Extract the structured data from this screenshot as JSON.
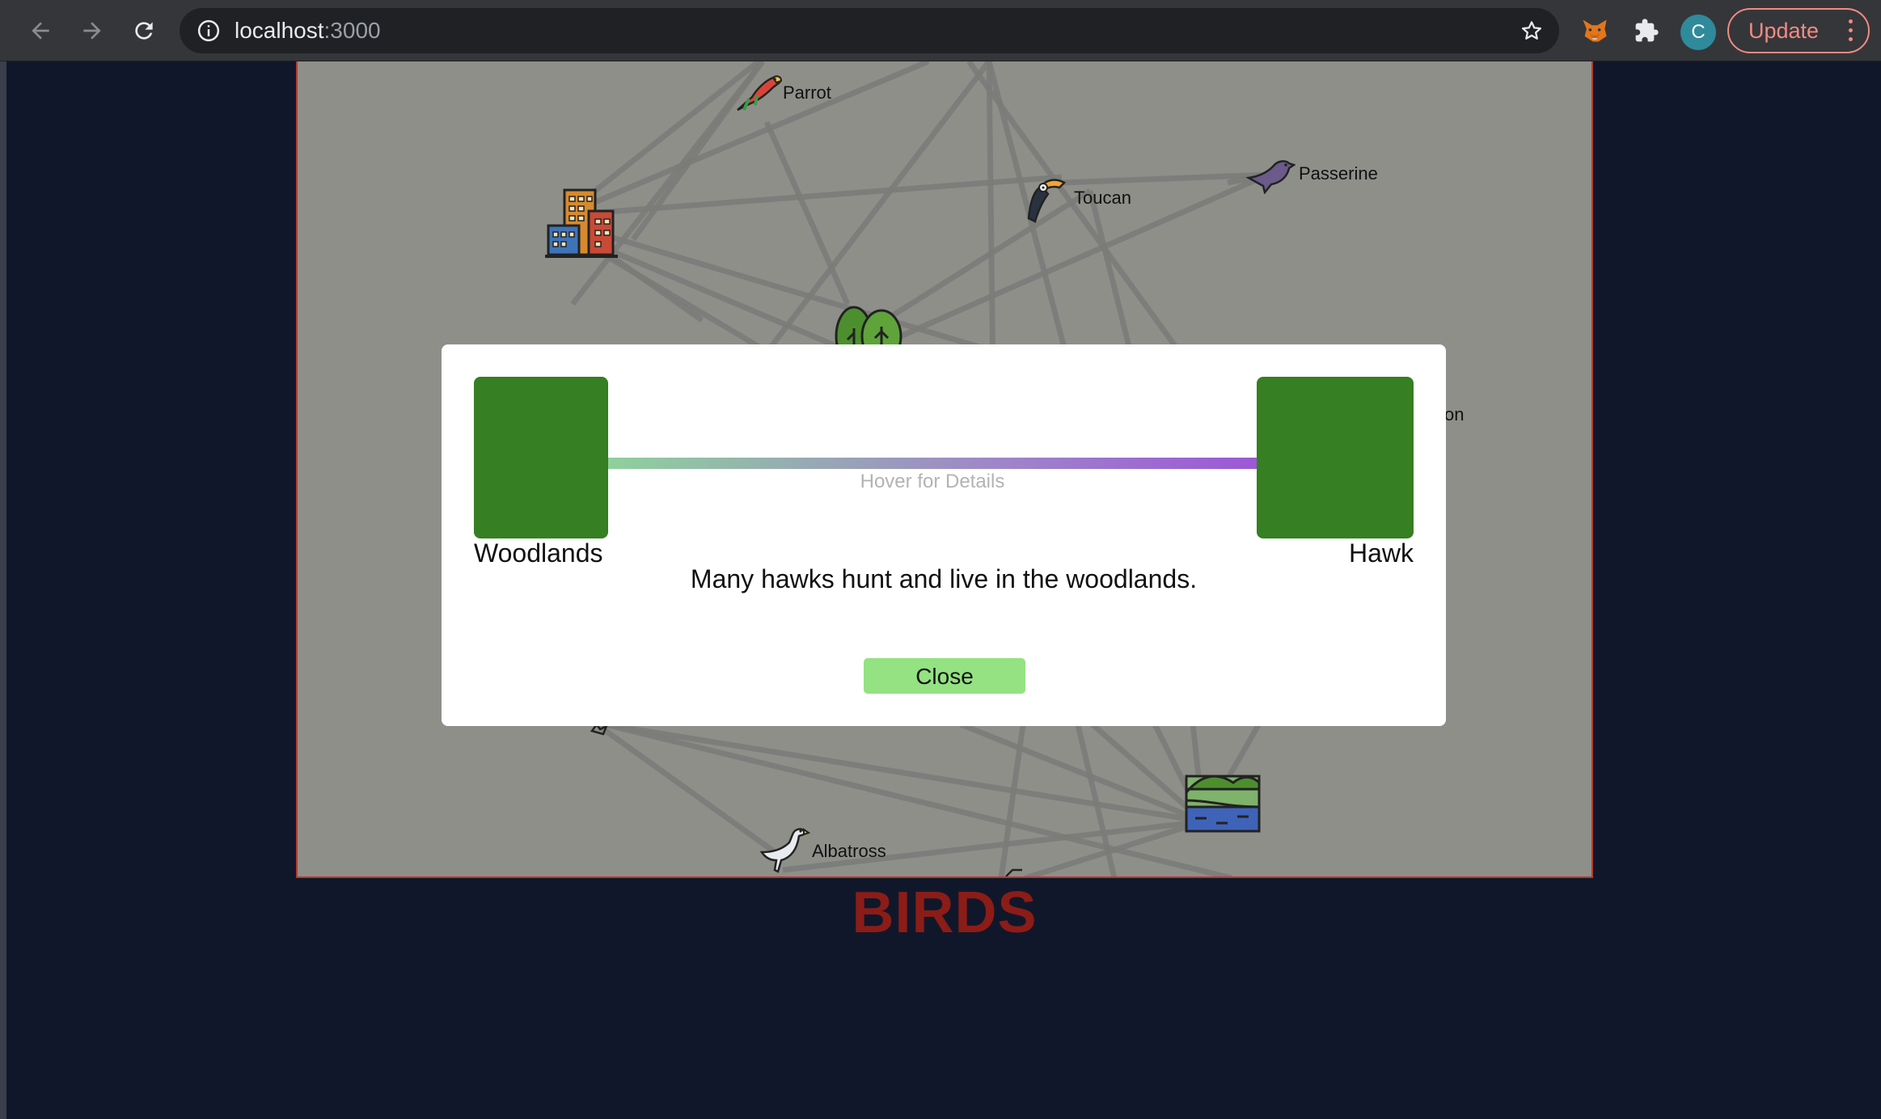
{
  "browser": {
    "url_host": "localhost",
    "url_port": ":3000",
    "profile_initial": "C",
    "update_label": "Update",
    "icons": [
      "back-arrow-icon",
      "forward-arrow-icon",
      "reload-icon",
      "site-info-icon",
      "bookmark-star-icon",
      "fox-extension-icon",
      "puzzle-extensions-icon",
      "more-vertical-icon"
    ]
  },
  "graph": {
    "nodes": {
      "parrot": "Parrot",
      "toucan": "Toucan",
      "passerine": "Passerine",
      "partial_right": "on",
      "albatross": "Albatross"
    },
    "icons": [
      "city-buildings-icon",
      "forest-trees-icon",
      "wetland-lake-icon",
      "parrot-icon",
      "toucan-icon",
      "passerine-icon",
      "albatross-icon"
    ],
    "edge_color": "#7a7a78",
    "background": "#8f8f8a"
  },
  "title": "BIRDS",
  "modal": {
    "left_name": "Woodlands",
    "right_name": "Hawk",
    "hover_hint": "Hover for Details",
    "description": "Many hawks hunt and live in the woodlands.",
    "close_label": "Close",
    "box_color": "#367f22",
    "gradient": [
      "#8fd09c",
      "#9c58d6"
    ]
  }
}
